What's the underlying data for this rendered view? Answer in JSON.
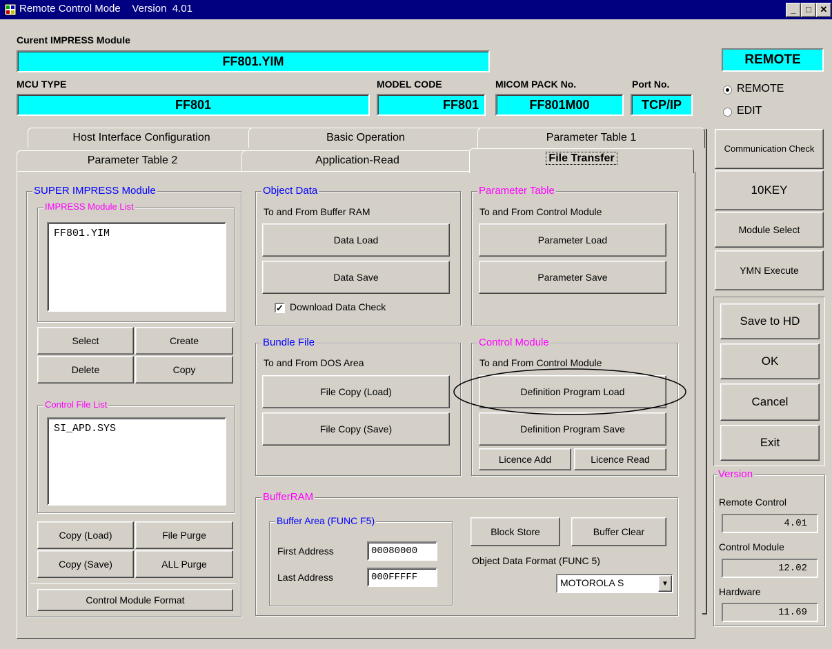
{
  "window": {
    "title": "Remote Control Mode",
    "version": "Version  4.01"
  },
  "header": {
    "module_label": "Curent IMPRESS Module",
    "module_value": "FF801.YIM",
    "mcu_label": "MCU TYPE",
    "mcu_value": "FF801",
    "model_label": "MODEL CODE",
    "model_value": "FF801",
    "micom_label": "MICOM PACK No.",
    "micom_value": "FF801M00",
    "port_label": "Port No.",
    "port_value": "TCP/IP"
  },
  "tabs": {
    "row1": [
      "Host Interface Configuration",
      "Basic Operation",
      "Parameter Table 1"
    ],
    "row2": [
      "Parameter Table 2",
      "Application-Read",
      "File Transfer"
    ]
  },
  "super": {
    "title": "SUPER IMPRESS Module",
    "list_title": "IMPRESS Module List",
    "list_items": [
      "FF801.YIM"
    ],
    "select": "Select",
    "create": "Create",
    "delete": "Delete",
    "copy": "Copy",
    "ctl_title": "Control File List",
    "ctl_items": [
      "SI_APD.SYS"
    ],
    "copy_load": "Copy (Load)",
    "file_purge": "File Purge",
    "copy_save": "Copy (Save)",
    "all_purge": "ALL Purge",
    "format": "Control Module Format"
  },
  "object": {
    "title": "Object Data",
    "sub": "To and From Buffer RAM",
    "load": "Data Load",
    "save": "Data Save",
    "check": "Download Data Check"
  },
  "param": {
    "title": "Parameter Table",
    "sub": "To and From Control Module",
    "load": "Parameter Load",
    "save": "Parameter Save"
  },
  "bundle": {
    "title": "Bundle File",
    "sub": "To and From DOS Area",
    "load": "File Copy (Load)",
    "save": "File Copy (Save)"
  },
  "control": {
    "title": "Control Module",
    "sub": "To and From Control Module",
    "load": "Definition Program Load",
    "save": "Definition Program Save",
    "lic_add": "Licence Add",
    "lic_read": "Licence Read"
  },
  "buffer": {
    "title": "BufferRAM",
    "area_title": "Buffer Area (FUNC F5)",
    "first_label": "First  Address",
    "first_value": "00080000",
    "last_label": "Last  Address",
    "last_value": "000FFFFF",
    "block_store": "Block Store",
    "clear": "Buffer Clear",
    "format_label": "Object Data Format (FUNC 5)",
    "format_value": "MOTOROLA S"
  },
  "right": {
    "status": "REMOTE",
    "radio_remote": "REMOTE",
    "radio_edit": "EDIT",
    "comm": "Communication Check",
    "tenkey": "10KEY",
    "module_select": "Module Select",
    "ymn": "YMN Execute",
    "save_hd": "Save to HD",
    "ok": "OK",
    "cancel": "Cancel",
    "exit": "Exit",
    "version_title": "Version",
    "rc_label": "Remote Control",
    "rc_value": "4.01",
    "cm_label": "Control Module",
    "cm_value": "12.02",
    "hw_label": "Hardware",
    "hw_value": "11.69"
  }
}
